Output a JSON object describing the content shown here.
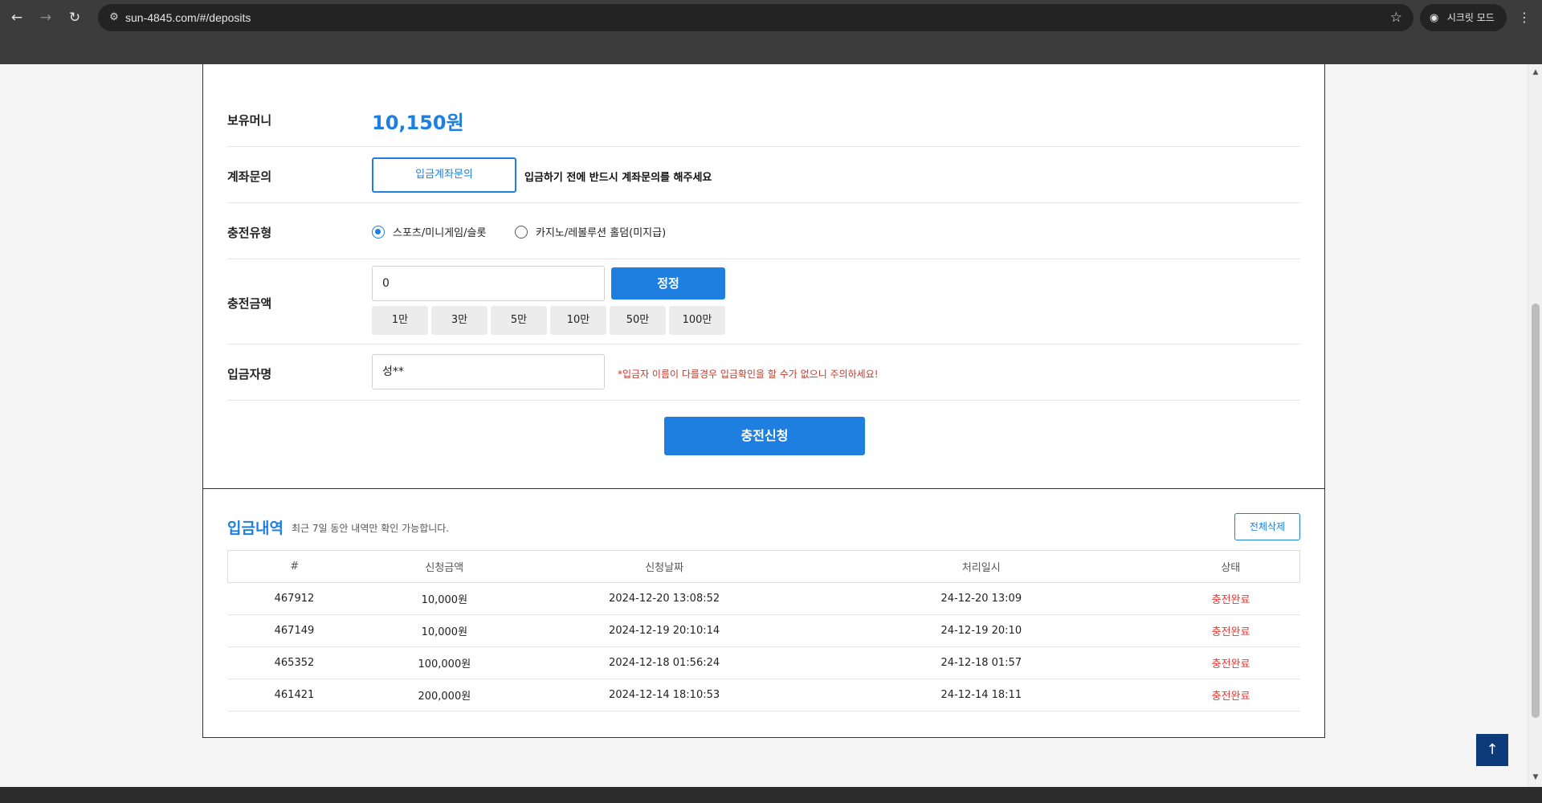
{
  "browser": {
    "url": "sun-4845.com/#/deposits",
    "incognito_label": "시크릿 모드"
  },
  "deposit_form": {
    "balance_label": "보유머니",
    "balance_value": "10,150원",
    "account_inquiry_label": "계좌문의",
    "account_inquiry_button": "입금계좌문의",
    "account_inquiry_notice": "입금하기 전에 반드시 계좌문의를 해주세요",
    "charge_type_label": "충전유형",
    "charge_types": [
      {
        "label": "스포츠/미니게임/슬롯",
        "checked": true
      },
      {
        "label": "카지노/레볼루션 홀덤(미지급)",
        "checked": false
      }
    ],
    "amount_label": "충전금액",
    "amount_value": "0",
    "reset_button": "정정",
    "quick_amounts": [
      "1만",
      "3만",
      "5만",
      "10만",
      "50만",
      "100만"
    ],
    "depositor_label": "입금자명",
    "depositor_value": "성**",
    "depositor_warning": "*입금자 이름이 다를경우 입금확인을 할 수가 없으니 주의하세요!",
    "submit_button": "충전신청"
  },
  "history": {
    "title": "입금내역",
    "subtitle": "최근 7일 동안 내역만 확인 가능합니다.",
    "delete_all_button": "전체삭제",
    "columns": [
      "#",
      "신청금액",
      "신청날짜",
      "처리일시",
      "상태"
    ],
    "rows": [
      {
        "id": "467912",
        "amount": "10,000원",
        "requested": "2024-12-20 13:08:52",
        "processed": "24-12-20 13:09",
        "status": "충전완료"
      },
      {
        "id": "467149",
        "amount": "10,000원",
        "requested": "2024-12-19 20:10:14",
        "processed": "24-12-19 20:10",
        "status": "충전완료"
      },
      {
        "id": "465352",
        "amount": "100,000원",
        "requested": "2024-12-18 01:56:24",
        "processed": "24-12-18 01:57",
        "status": "충전완료"
      },
      {
        "id": "461421",
        "amount": "200,000원",
        "requested": "2024-12-14 18:10:53",
        "processed": "24-12-14 18:11",
        "status": "충전완료"
      }
    ]
  },
  "colors": {
    "accent": "#1e7fe0",
    "status_complete": "#e53935",
    "warning": "#c0392b",
    "top_button": "#0d3a78"
  }
}
